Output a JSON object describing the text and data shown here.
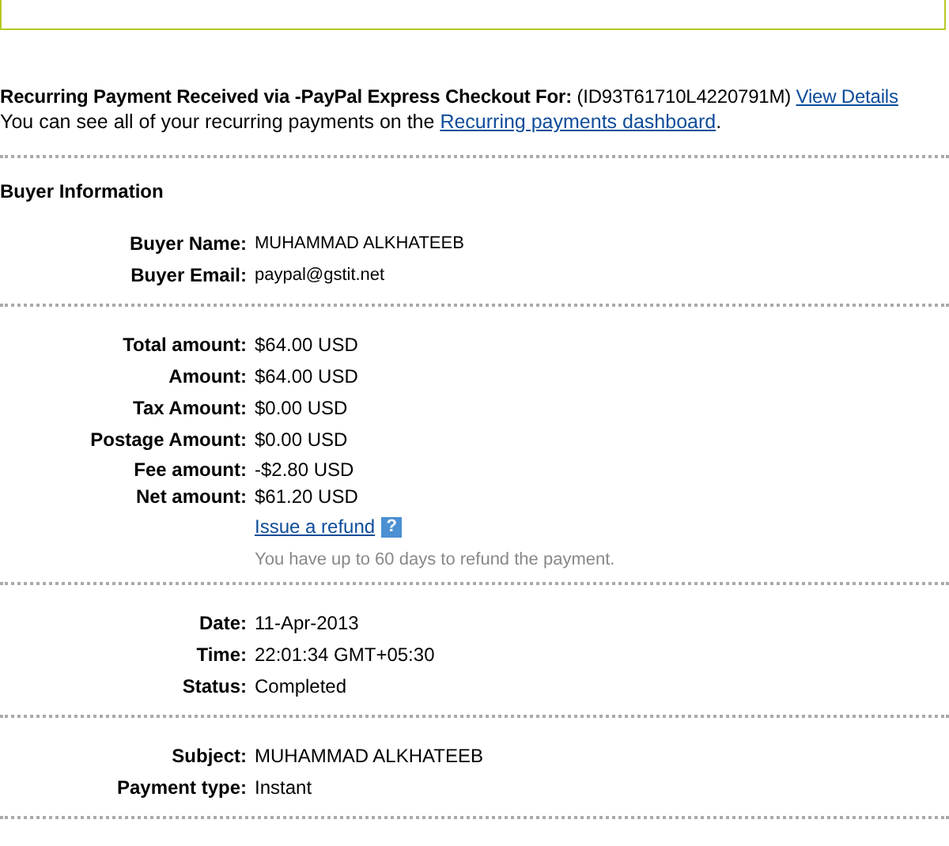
{
  "header": {
    "title": "Recurring Payment Received via -PayPal Express Checkout For:",
    "id": "(ID93T61710L4220791M)",
    "link": "View Details",
    "note": "You can see all of your recurring payments on the",
    "note_link": "Recurring payments dashboard",
    "note_end": "."
  },
  "sections": [
    {
      "title": "Buyer Information",
      "rows": [
        {
          "label": "Buyer Name:",
          "value": "MUHAMMAD ALKHATEEB",
          "kind": "small"
        },
        {
          "label": "Buyer Email:",
          "value": "paypal@gstit.net",
          "kind": "small"
        }
      ]
    },
    {
      "rows": [
        {
          "label": "Total amount:",
          "value": "$64.00 USD",
          "kind": "normal"
        },
        {
          "label": "Amount:",
          "value": "$64.00 USD",
          "kind": "normal"
        },
        {
          "label": "Tax Amount:",
          "value": "$0.00 USD",
          "kind": "normal"
        },
        {
          "label": "Postage Amount:",
          "value": "$0.00 USD",
          "kind": "normal"
        },
        {
          "label": "Fee amount:",
          "value": "-$2.80 USD",
          "kind": "tight"
        },
        {
          "label": "Net amount:",
          "value": "$61.20 USD",
          "kind": "tight"
        }
      ],
      "refund": {
        "link": "Issue a refund",
        "help": "?",
        "note": "You have up to 60 days to refund the payment."
      }
    },
    {
      "rows": [
        {
          "label": "Date:",
          "value": "11-Apr-2013",
          "kind": "normal"
        },
        {
          "label": "Time:",
          "value": "22:01:34 GMT+05:30",
          "kind": "normal"
        },
        {
          "label": "Status:",
          "value": "Completed",
          "kind": "normal"
        }
      ]
    },
    {
      "rows": [
        {
          "label": "Subject:",
          "value": "MUHAMMAD ALKHATEEB",
          "kind": "normal"
        },
        {
          "label": "Payment type:",
          "value": "Instant",
          "kind": "normal"
        }
      ]
    }
  ]
}
